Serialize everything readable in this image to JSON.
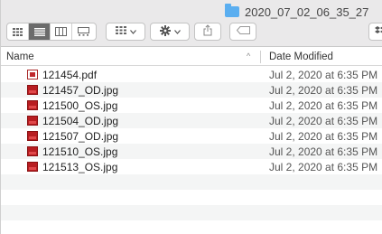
{
  "window": {
    "title": "2020_07_02_06_35_27"
  },
  "toolbar": {
    "view_icons": [
      "grid-view-icon",
      "list-view-icon",
      "column-view-icon",
      "gallery-view-icon"
    ],
    "group_icon": "group-icon",
    "action_icon": "gear-icon",
    "share_icon": "share-icon",
    "tag_icon": "tag-icon"
  },
  "columns": {
    "name": "Name",
    "date_modified": "Date Modified",
    "sort_indicator": "^"
  },
  "files": [
    {
      "name": "121454.pdf",
      "type": "pdf",
      "date": "Jul 2, 2020 at 6:35 PM"
    },
    {
      "name": "121457_OD.jpg",
      "type": "jpg",
      "date": "Jul 2, 2020 at 6:35 PM"
    },
    {
      "name": "121500_OS.jpg",
      "type": "jpg",
      "date": "Jul 2, 2020 at 6:35 PM"
    },
    {
      "name": "121504_OD.jpg",
      "type": "jpg",
      "date": "Jul 2, 2020 at 6:35 PM"
    },
    {
      "name": "121507_OD.jpg",
      "type": "jpg",
      "date": "Jul 2, 2020 at 6:35 PM"
    },
    {
      "name": "121510_OS.jpg",
      "type": "jpg",
      "date": "Jul 2, 2020 at 6:35 PM"
    },
    {
      "name": "121513_OS.jpg",
      "type": "jpg",
      "date": "Jul 2, 2020 at 6:35 PM"
    }
  ],
  "colors": {
    "folder": "#5aaef0",
    "jpg_icon": "#b81d21",
    "pdf_icon": "#c0282c",
    "stripe": "#f4f5f5"
  }
}
